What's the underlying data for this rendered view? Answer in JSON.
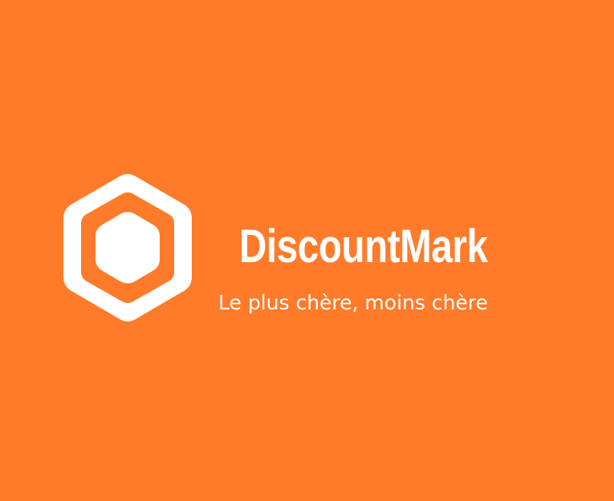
{
  "colors": {
    "background": "#FF7B2A",
    "foreground": "#FFFFFF"
  },
  "logo": {
    "icon": "hexagon-ring-icon"
  },
  "brand": {
    "name": "DiscountMark",
    "tagline": "Le plus chère, moins chère"
  }
}
